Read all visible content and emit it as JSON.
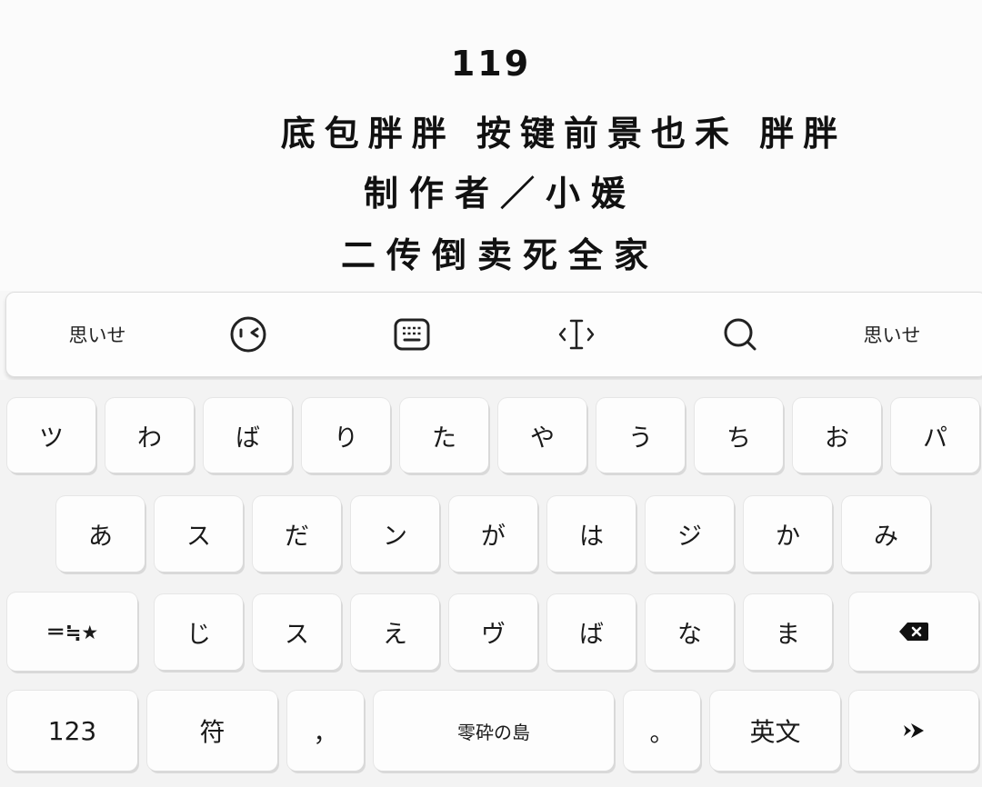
{
  "header": {
    "line1": "119",
    "line2": "底包胖胖 按键前景也禾 胖胖",
    "line3": "制作者／小媛",
    "line4": "二传倒卖死全家"
  },
  "toolbar": {
    "left_label": "思いせ",
    "right_label": "思いせ",
    "icons": [
      "emoji-face-icon",
      "keyboard-icon",
      "cursor-move-icon",
      "search-icon"
    ]
  },
  "keyboard": {
    "row1": [
      "ツ",
      "わ",
      "ば",
      "り",
      "た",
      "や",
      "う",
      "ち",
      "お",
      "パ"
    ],
    "row2": [
      "あ",
      "ス",
      "だ",
      "ン",
      "が",
      "は",
      "ジ",
      "か",
      "み"
    ],
    "row3_left": "＝≒★",
    "row3": [
      "じ",
      "ス",
      "え",
      "ヴ",
      "ば",
      "な",
      "ま"
    ],
    "row4": {
      "numbers": "123",
      "symbols": "符",
      "comma": "，",
      "space": "零砕の島",
      "period": "。",
      "english": "英文"
    }
  }
}
